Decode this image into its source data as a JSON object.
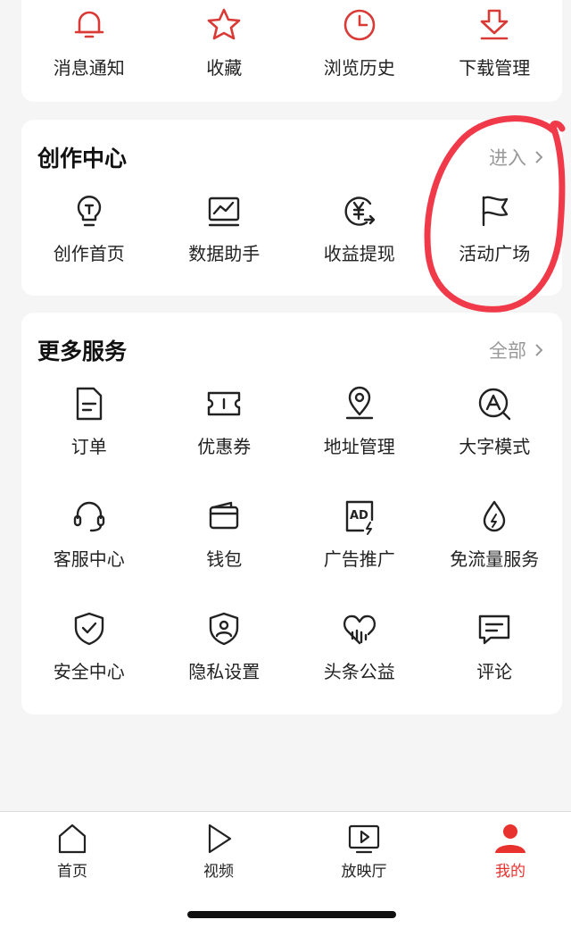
{
  "top_row": [
    {
      "label": "消息通知",
      "icon": "bell-icon"
    },
    {
      "label": "收藏",
      "icon": "star-icon"
    },
    {
      "label": "浏览历史",
      "icon": "clock-icon"
    },
    {
      "label": "下载管理",
      "icon": "download-icon"
    }
  ],
  "create_center": {
    "title": "创作中心",
    "link": "进入",
    "items": [
      {
        "label": "创作首页",
        "icon": "lightbulb-icon"
      },
      {
        "label": "数据助手",
        "icon": "chart-monitor-icon"
      },
      {
        "label": "收益提现",
        "icon": "yen-withdraw-icon"
      },
      {
        "label": "活动广场",
        "icon": "flag-icon"
      }
    ]
  },
  "more_services": {
    "title": "更多服务",
    "link": "全部",
    "rows": [
      [
        {
          "label": "订单",
          "icon": "document-icon"
        },
        {
          "label": "优惠券",
          "icon": "ticket-icon"
        },
        {
          "label": "地址管理",
          "icon": "location-pin-icon"
        },
        {
          "label": "大字模式",
          "icon": "font-search-icon"
        }
      ],
      [
        {
          "label": "客服中心",
          "icon": "headset-icon"
        },
        {
          "label": "钱包",
          "icon": "wallet-icon"
        },
        {
          "label": "广告推广",
          "icon": "ad-icon"
        },
        {
          "label": "免流量服务",
          "icon": "data-drop-icon"
        }
      ],
      [
        {
          "label": "安全中心",
          "icon": "shield-check-icon"
        },
        {
          "label": "隐私设置",
          "icon": "shield-user-icon"
        },
        {
          "label": "头条公益",
          "icon": "heart-chart-icon"
        },
        {
          "label": "评论",
          "icon": "comment-icon"
        }
      ]
    ]
  },
  "tabs": [
    {
      "label": "首页",
      "icon": "home-icon",
      "active": false
    },
    {
      "label": "视频",
      "icon": "play-icon",
      "active": false
    },
    {
      "label": "放映厅",
      "icon": "tv-play-icon",
      "active": false
    },
    {
      "label": "我的",
      "icon": "user-icon",
      "active": true
    }
  ],
  "colors": {
    "accent": "#e8322e",
    "annotation": "#f03a4a",
    "muted": "#999999"
  }
}
